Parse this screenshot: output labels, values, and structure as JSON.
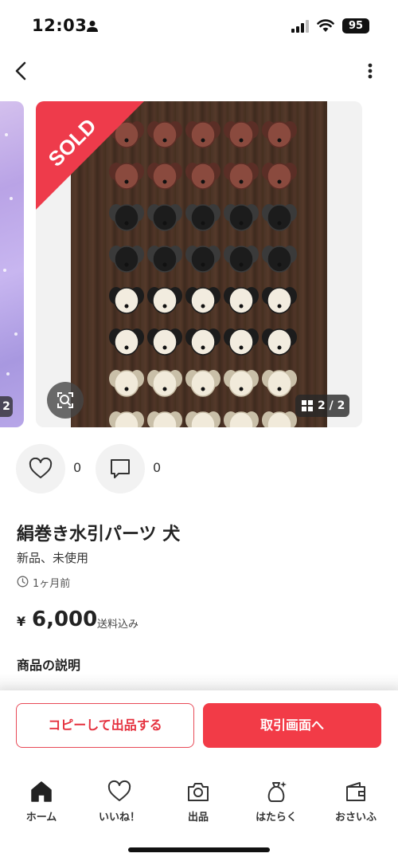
{
  "status_bar": {
    "time": "12:03",
    "battery": "95"
  },
  "carousel": {
    "prev_counter": "2",
    "sold_label": "SOLD",
    "counter": "2 / 2"
  },
  "actions": {
    "like_count": "0",
    "comment_count": "0"
  },
  "product": {
    "title": "絹巻き水引パーツ 犬",
    "condition": "新品、未使用",
    "posted": "1ヶ月前",
    "currency": "¥",
    "price": "6,000",
    "shipping": "送料込み",
    "description_heading": "商品の説明"
  },
  "buttons": {
    "copy_listing": "コピーして出品する",
    "trade_screen": "取引画面へ"
  },
  "tabs": [
    {
      "label": "ホーム",
      "icon": "home-icon"
    },
    {
      "label": "いいね！",
      "icon": "heart-icon"
    },
    {
      "label": "出品",
      "icon": "camera-icon"
    },
    {
      "label": "はたらく",
      "icon": "money-bag-icon"
    },
    {
      "label": "おさいふ",
      "icon": "wallet-icon"
    }
  ],
  "colors": {
    "accent": "#f23b47",
    "sold_ribbon": "#ee3b4b"
  }
}
